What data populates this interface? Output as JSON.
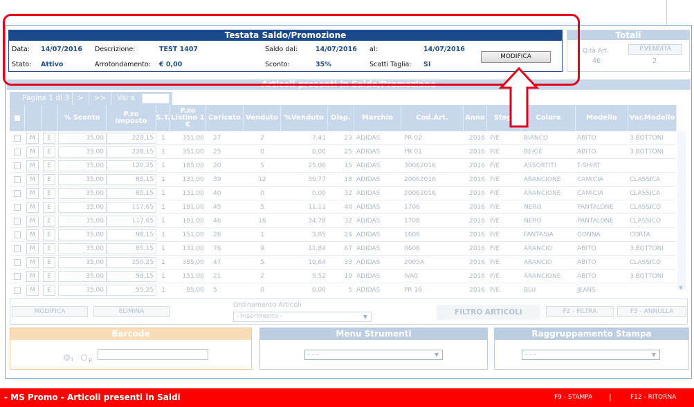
{
  "testata": {
    "title": "Testata Saldo/Promozione",
    "data_label": "Data:",
    "data_value": "14/07/2016",
    "descrizione_label": "Descrizione:",
    "descrizione_value": "TEST 1407",
    "saldo_dal_label": "Saldo dal:",
    "saldo_dal_value": "14/07/2016",
    "al_label": "al:",
    "al_value": "14/07/2016",
    "stato_label": "Stato:",
    "stato_value": "Attivo",
    "arrotondamento_label": "Arrotondamento:",
    "arrotondamento_value": "€ 0,00",
    "sconto_label": "Sconto:",
    "sconto_value": "35%",
    "scatti_label": "Scatti Taglia:",
    "scatti_value": "SI",
    "modifica_label": "MODIFICA"
  },
  "totali": {
    "title": "Totali",
    "qta_label": "Q.tà Art.",
    "qta_value": "46",
    "pvendita_label": "P.VENDITA",
    "pvendita_value": "2"
  },
  "articoli": {
    "title": "Articoli presenti in Saldo/Promozione",
    "pager_label": "Pagina 1 di 3",
    "next": ">",
    "last": ">>",
    "goto_label": "Vai a"
  },
  "columns": [
    "% Sconto",
    "P.zo Imposto",
    "S.T.",
    "P.zo Listino 1 €",
    "Caricato",
    "Venduto",
    "%Venduto",
    "Disp.",
    "Marchio",
    "Cod.Art.",
    "Anno",
    "Stagi",
    "Colore",
    "Modello",
    "Var.Modello"
  ],
  "row_buttons": {
    "m": "M",
    "e": "E"
  },
  "rows": [
    [
      "35,00",
      "228,15",
      "1",
      "351,00",
      "27",
      "2",
      "7,41",
      "23",
      "ADIDAS",
      "PR 02",
      "2016",
      "P/E",
      "BIANCO",
      "ABITO",
      "3 BOTTONI"
    ],
    [
      "35,00",
      "228,15",
      "1",
      "351,00",
      "25",
      "0",
      "0,00",
      "25",
      "ADIDAS",
      "PR 01",
      "2016",
      "P/E",
      "BEIGE",
      "ABITO",
      "3 BOTTONI"
    ],
    [
      "35,00",
      "120,25",
      "1",
      "185,00",
      "20",
      "5",
      "25,00",
      "15",
      "ADIDAS",
      "30062016",
      "2016",
      "P/E",
      "ASSORTITI",
      "T-SHIRT",
      ""
    ],
    [
      "35,00",
      "85,15",
      "1",
      "131,00",
      "39",
      "12",
      "30,77",
      "18",
      "ADIDAS",
      "20062016",
      "2016",
      "P/E",
      "ARANCIONE",
      "CAMICIA",
      "CLASSICA"
    ],
    [
      "35,00",
      "85,15",
      "1",
      "131,00",
      "40",
      "0",
      "0,00",
      "32",
      "ADIDAS",
      "20062016",
      "2016",
      "P/E",
      "ARANCIONE",
      "CAMICIA",
      "CLASSICA"
    ],
    [
      "35,00",
      "117,65",
      "1",
      "181,00",
      "45",
      "5",
      "11,11",
      "40",
      "ADIDAS",
      "1706",
      "2016",
      "P/E",
      "NERO",
      "PANTALONE",
      "CLASSICO"
    ],
    [
      "35,00",
      "117,65",
      "1",
      "181,00",
      "46",
      "16",
      "34,78",
      "32",
      "ADIDAS",
      "1706",
      "2016",
      "P/E",
      "NERO",
      "PANTALONE",
      "CLASSICO"
    ],
    [
      "35,00",
      "98,15",
      "1",
      "151,00",
      "26",
      "1",
      "3,85",
      "24",
      "ADIDAS",
      "1606",
      "2016",
      "P/E",
      "FANTASIA",
      "GONNA",
      "CORTA"
    ],
    [
      "35,00",
      "85,15",
      "1",
      "131,00",
      "76",
      "9",
      "11,84",
      "67",
      "ADIDAS",
      "0606",
      "2016",
      "P/E",
      "ARANCIO",
      "ABITO",
      "3 BOTTONI"
    ],
    [
      "35,00",
      "250,25",
      "1",
      "385,00",
      "47",
      "5",
      "10,64",
      "33",
      "ADIDAS",
      "2005A",
      "2016",
      "P/E",
      "ARANCIO",
      "ABITO",
      "CLASSICO"
    ],
    [
      "35,00",
      "98,15",
      "1",
      "151,00",
      "21",
      "2",
      "9,52",
      "19",
      "ADIDAS",
      "IVA0",
      "2016",
      "P/E",
      "ARANCIONE",
      "ABITO",
      "3 BOTTONI"
    ],
    [
      "35,00",
      "55,25",
      "1",
      "85,00",
      "5",
      "0",
      "0,00",
      "5",
      "ADIDAS",
      "PR 16",
      "2016",
      "P/E",
      "BLU",
      "JEANS",
      ""
    ]
  ],
  "actions": {
    "modifica": "MODIFICA",
    "elimina": "ELIMINA",
    "ordinamento_label": "Ordinamento Articoli",
    "ordinamento_value": "- Inserimento -",
    "filtro": "FILTRO ARTICOLI",
    "f2": "F2 - FILTRA",
    "f3": "F3 - ANNULLA"
  },
  "barcode": {
    "title": "Barcode",
    "radio_i": "I",
    "radio_p": "p"
  },
  "menu_strumenti": {
    "title": "Menu Strumenti",
    "value": "- - -"
  },
  "raggruppamento": {
    "title": "Raggruppamento Stampa",
    "value": "- - -"
  },
  "footer": {
    "title": "- MS Promo - Articoli presenti in Saldi",
    "f9": "F9 - STAMPA",
    "separator": "|",
    "f12": "F12 - RITORNA"
  },
  "colors": {
    "header_blue": "#1a4a8c",
    "pale_blue": "#c8d8ea",
    "highlight_red": "#e3001b",
    "footer_red": "#ff0000",
    "barcode_orange": "#f8dcb8"
  }
}
